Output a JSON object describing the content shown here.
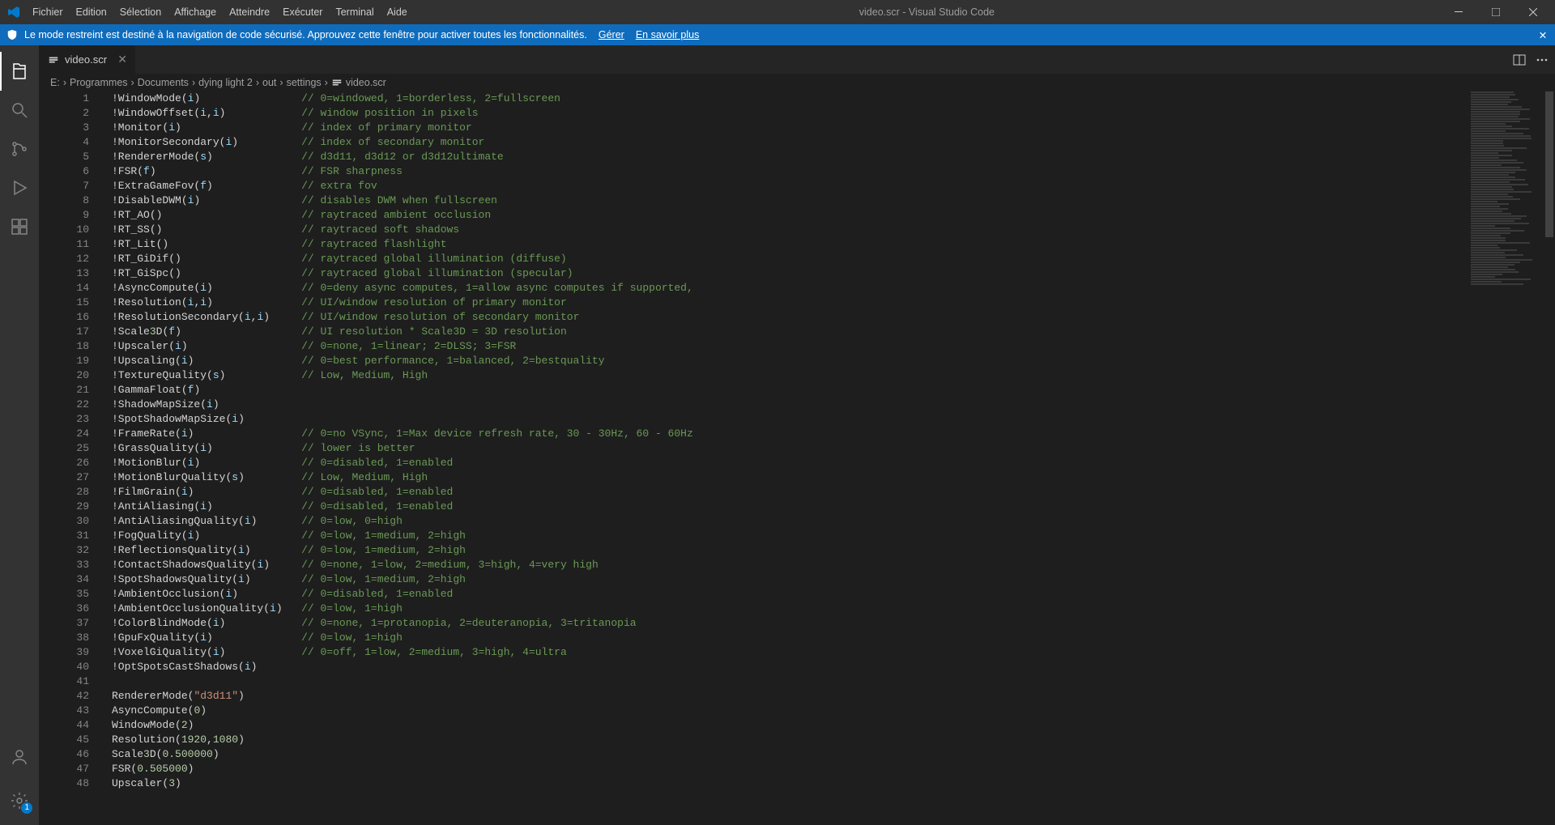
{
  "window": {
    "title": "video.scr - Visual Studio Code"
  },
  "menubar": [
    "Fichier",
    "Edition",
    "Sélection",
    "Affichage",
    "Atteindre",
    "Exécuter",
    "Terminal",
    "Aide"
  ],
  "notif": {
    "text": "Le mode restreint est destiné à la navigation de code sécurisé. Approuvez cette fenêtre pour activer toutes les fonctionnalités.",
    "manage": "Gérer",
    "learn": "En savoir plus"
  },
  "tab": {
    "name": "video.scr"
  },
  "breadcrumbs": [
    "E:",
    "Programmes",
    "Documents",
    "dying light 2",
    "out",
    "settings",
    "video.scr"
  ],
  "gear_badge": "1",
  "code": [
    {
      "n": 1,
      "fn": "!WindowMode(i)",
      "cm": "// 0=windowed, 1=borderless, 2=fullscreen"
    },
    {
      "n": 2,
      "fn": "!WindowOffset(i,i)",
      "cm": "// window position in pixels"
    },
    {
      "n": 3,
      "fn": "!Monitor(i)",
      "cm": "// index of primary monitor"
    },
    {
      "n": 4,
      "fn": "!MonitorSecondary(i)",
      "cm": "// index of secondary monitor"
    },
    {
      "n": 5,
      "fn": "!RendererMode(s)",
      "cm": "// d3d11, d3d12 or d3d12ultimate"
    },
    {
      "n": 6,
      "fn": "!FSR(f)",
      "cm": "// FSR sharpness"
    },
    {
      "n": 7,
      "fn": "!ExtraGameFov(f)",
      "cm": "// extra fov"
    },
    {
      "n": 8,
      "fn": "!DisableDWM(i)",
      "cm": "// disables DWM when fullscreen"
    },
    {
      "n": 9,
      "fn": "!RT_AO()",
      "cm": "// raytraced ambient occlusion"
    },
    {
      "n": 10,
      "fn": "!RT_SS()",
      "cm": "// raytraced soft shadows"
    },
    {
      "n": 11,
      "fn": "!RT_Lit()",
      "cm": "// raytraced flashlight"
    },
    {
      "n": 12,
      "fn": "!RT_GiDif()",
      "cm": "// raytraced global illumination (diffuse)"
    },
    {
      "n": 13,
      "fn": "!RT_GiSpc()",
      "cm": "// raytraced global illumination (specular)"
    },
    {
      "n": 14,
      "fn": "!AsyncCompute(i)",
      "cm": "// 0=deny async computes, 1=allow async computes if supported,"
    },
    {
      "n": 15,
      "fn": "!Resolution(i,i)",
      "cm": "// UI/window resolution of primary monitor"
    },
    {
      "n": 16,
      "fn": "!ResolutionSecondary(i,i)",
      "cm": "// UI/window resolution of secondary monitor"
    },
    {
      "n": 17,
      "fn": "!Scale3D(f)",
      "cm": "// UI resolution * Scale3D = 3D resolution"
    },
    {
      "n": 18,
      "fn": "!Upscaler(i)",
      "cm": "// 0=none, 1=linear; 2=DLSS; 3=FSR"
    },
    {
      "n": 19,
      "fn": "!Upscaling(i)",
      "cm": "// 0=best performance, 1=balanced, 2=bestquality"
    },
    {
      "n": 20,
      "fn": "!TextureQuality(s)",
      "cm": "// Low, Medium, High"
    },
    {
      "n": 21,
      "fn": "!GammaFloat(f)",
      "cm": ""
    },
    {
      "n": 22,
      "fn": "!ShadowMapSize(i)",
      "cm": ""
    },
    {
      "n": 23,
      "fn": "!SpotShadowMapSize(i)",
      "cm": ""
    },
    {
      "n": 24,
      "fn": "!FrameRate(i)",
      "cm": "// 0=no VSync, 1=Max device refresh rate, 30 - 30Hz, 60 - 60Hz"
    },
    {
      "n": 25,
      "fn": "!GrassQuality(i)",
      "cm": "// lower is better"
    },
    {
      "n": 26,
      "fn": "!MotionBlur(i)",
      "cm": "// 0=disabled, 1=enabled"
    },
    {
      "n": 27,
      "fn": "!MotionBlurQuality(s)",
      "cm": "// Low, Medium, High"
    },
    {
      "n": 28,
      "fn": "!FilmGrain(i)",
      "cm": "// 0=disabled, 1=enabled"
    },
    {
      "n": 29,
      "fn": "!AntiAliasing(i)",
      "cm": "// 0=disabled, 1=enabled"
    },
    {
      "n": 30,
      "fn": "!AntiAliasingQuality(i)",
      "cm": "// 0=low, 0=high"
    },
    {
      "n": 31,
      "fn": "!FogQuality(i)",
      "cm": "// 0=low, 1=medium, 2=high"
    },
    {
      "n": 32,
      "fn": "!ReflectionsQuality(i)",
      "cm": "// 0=low, 1=medium, 2=high"
    },
    {
      "n": 33,
      "fn": "!ContactShadowsQuality(i)",
      "cm": "// 0=none, 1=low, 2=medium, 3=high, 4=very high"
    },
    {
      "n": 34,
      "fn": "!SpotShadowsQuality(i)",
      "cm": "// 0=low, 1=medium, 2=high"
    },
    {
      "n": 35,
      "fn": "!AmbientOcclusion(i)",
      "cm": "// 0=disabled, 1=enabled"
    },
    {
      "n": 36,
      "fn": "!AmbientOcclusionQuality(i)",
      "cm": "// 0=low, 1=high"
    },
    {
      "n": 37,
      "fn": "!ColorBlindMode(i)",
      "cm": "// 0=none, 1=protanopia, 2=deuteranopia, 3=tritanopia"
    },
    {
      "n": 38,
      "fn": "!GpuFxQuality(i)",
      "cm": "// 0=low, 1=high"
    },
    {
      "n": 39,
      "fn": "!VoxelGiQuality(i)",
      "cm": "// 0=off, 1=low, 2=medium, 3=high, 4=ultra"
    },
    {
      "n": 40,
      "fn": "!OptSpotsCastShadows(i)",
      "cm": ""
    },
    {
      "n": 41,
      "fn": "",
      "cm": ""
    },
    {
      "n": 42,
      "fn": "RendererMode(\"d3d11\")",
      "cm": ""
    },
    {
      "n": 43,
      "fn": "AsyncCompute(0)",
      "cm": ""
    },
    {
      "n": 44,
      "fn": "WindowMode(2)",
      "cm": ""
    },
    {
      "n": 45,
      "fn": "Resolution(1920,1080)",
      "cm": ""
    },
    {
      "n": 46,
      "fn": "Scale3D(0.500000)",
      "cm": ""
    },
    {
      "n": 47,
      "fn": "FSR(0.505000)",
      "cm": ""
    },
    {
      "n": 48,
      "fn": "Upscaler(3)",
      "cm": ""
    }
  ]
}
